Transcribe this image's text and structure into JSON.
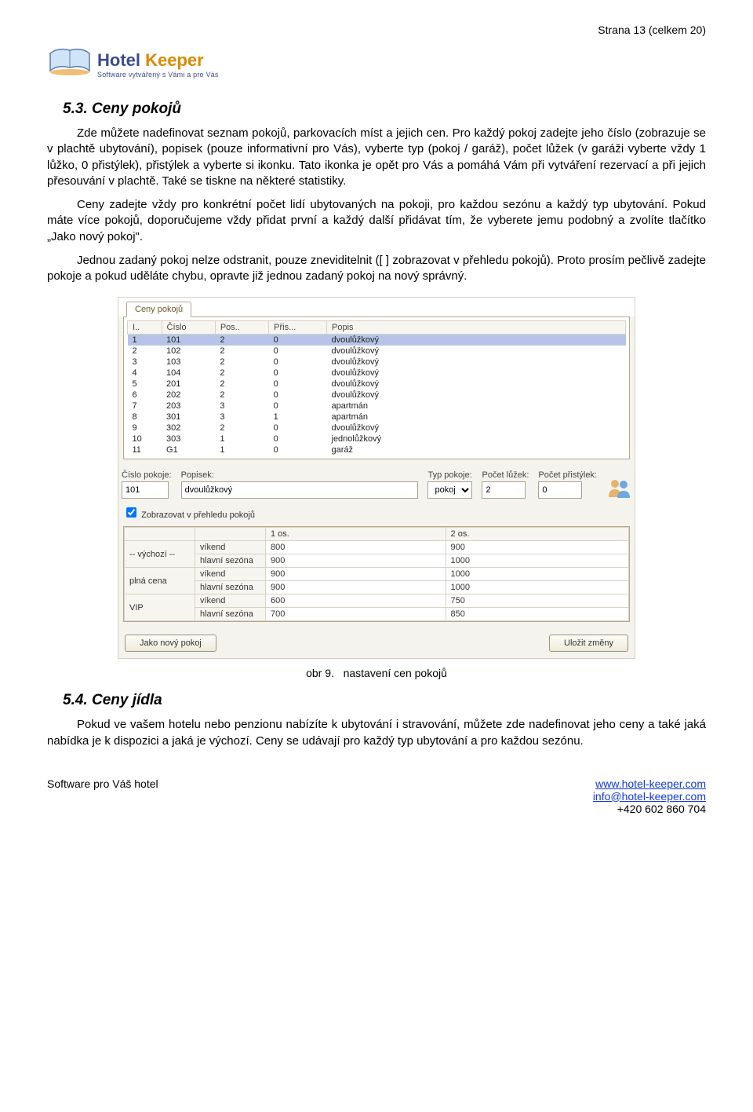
{
  "header": {
    "page_counter": "Strana 13 (celkem 20)"
  },
  "logo": {
    "brand_hotel": "Hotel",
    "brand_keeper": "Keeper",
    "tagline": "Software vytvářený s Vámi a pro Vás"
  },
  "section53": {
    "heading": "5.3. Ceny pokojů",
    "p1": "Zde můžete nadefinovat seznam pokojů, parkovacích míst a jejich cen. Pro každý pokoj zadejte jeho číslo (zobrazuje se v plachtě ubytování), popisek (pouze informativní pro Vás), vyberte typ (pokoj / garáž), počet lůžek (v garáži vyberte vždy 1 lůžko, 0 přistýlek), přistýlek a vyberte si ikonku. Tato ikonka je opět pro Vás a pomáhá Vám při vytváření rezervací a při jejich přesouvání v plachtě. Také se tiskne na některé statistiky.",
    "p2": "Ceny zadejte vždy pro konkrétní počet lidí ubytovaných na pokoji, pro každou sezónu a každý typ ubytování. Pokud máte více pokojů, doporučujeme vždy přidat první a každý další přidávat tím, že vyberete jemu podobný a zvolíte tlačítko „Jako nový pokoj\".",
    "p3": "Jednou zadaný pokoj nelze odstranit, pouze zneviditelnit ([ ] zobrazovat v přehledu pokojů). Proto prosím pečlivě zadejte pokoje a pokud uděláte chybu, opravte již jednou zadaný pokoj na nový správný."
  },
  "ui": {
    "tab_label": "Ceny pokojů",
    "list": {
      "cols": {
        "idx": "I..",
        "num": "Číslo",
        "pos": "Pos..",
        "pris": "Přis...",
        "desc": "Popis"
      },
      "rows": [
        {
          "i": "1",
          "n": "101",
          "p": "2",
          "r": "0",
          "d": "dvoulůžkový"
        },
        {
          "i": "2",
          "n": "102",
          "p": "2",
          "r": "0",
          "d": "dvoulůžkový"
        },
        {
          "i": "3",
          "n": "103",
          "p": "2",
          "r": "0",
          "d": "dvoulůžkový"
        },
        {
          "i": "4",
          "n": "104",
          "p": "2",
          "r": "0",
          "d": "dvoulůžkový"
        },
        {
          "i": "5",
          "n": "201",
          "p": "2",
          "r": "0",
          "d": "dvoulůžkový"
        },
        {
          "i": "6",
          "n": "202",
          "p": "2",
          "r": "0",
          "d": "dvoulůžkový"
        },
        {
          "i": "7",
          "n": "203",
          "p": "3",
          "r": "0",
          "d": "apartmán"
        },
        {
          "i": "8",
          "n": "301",
          "p": "3",
          "r": "1",
          "d": "apartmán"
        },
        {
          "i": "9",
          "n": "302",
          "p": "2",
          "r": "0",
          "d": "dvoulůžkový"
        },
        {
          "i": "10",
          "n": "303",
          "p": "1",
          "r": "0",
          "d": "jednolůžkový"
        },
        {
          "i": "11",
          "n": "G1",
          "p": "1",
          "r": "0",
          "d": "garáž"
        }
      ]
    },
    "form": {
      "room_no_label": "Číslo pokoje:",
      "room_no_value": "101",
      "desc_label": "Popisek:",
      "desc_value": "dvoulůžkový",
      "type_label": "Typ pokoje:",
      "type_value": "pokoj",
      "beds_label": "Počet lůžek:",
      "beds_value": "2",
      "extra_label": "Počet přistýlek:",
      "extra_value": "0",
      "show_chk_label": "Zobrazovat v přehledu pokojů"
    },
    "prices": {
      "headers": {
        "os1": "1 os.",
        "os2": "2 os."
      },
      "groups": [
        {
          "name": "-- výchozí --",
          "rows": [
            {
              "label": "víkend",
              "v1": "800",
              "v2": "900"
            },
            {
              "label": "hlavní sezóna",
              "v1": "900",
              "v2": "1000"
            }
          ]
        },
        {
          "name": "plná cena",
          "rows": [
            {
              "label": "víkend",
              "v1": "900",
              "v2": "1000"
            },
            {
              "label": "hlavní sezóna",
              "v1": "900",
              "v2": "1000"
            }
          ]
        },
        {
          "name": "VIP",
          "rows": [
            {
              "label": "víkend",
              "v1": "600",
              "v2": "750"
            },
            {
              "label": "hlavní sezóna",
              "v1": "700",
              "v2": "850"
            }
          ]
        }
      ]
    },
    "buttons": {
      "new_room": "Jako nový pokoj",
      "save": "Uložit změny"
    }
  },
  "figure_caption": {
    "label": "obr 9.",
    "text": "nastavení cen pokojů"
  },
  "section54": {
    "heading": "5.4. Ceny jídla",
    "p1": "Pokud ve vašem hotelu nebo penzionu nabízíte k ubytování i stravování, můžete zde nadefinovat jeho ceny a také jaká nabídka je k dispozici a jaká je výchozí. Ceny se udávají pro každý typ ubytování a pro každou sezónu."
  },
  "footer": {
    "left": "Software pro Váš hotel",
    "url": "www.hotel-keeper.com",
    "mail": "info@hotel-keeper.com",
    "phone": "+420 602 860 704"
  }
}
